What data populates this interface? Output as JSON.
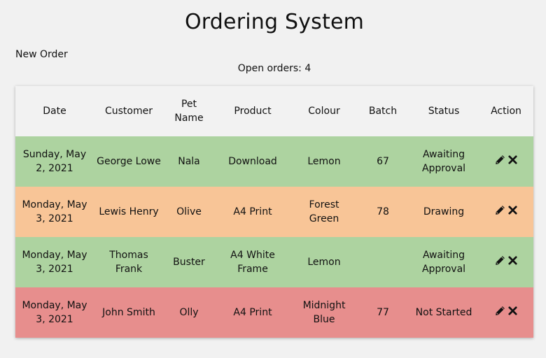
{
  "title": "Ordering System",
  "new_order_label": "New Order",
  "open_orders": "Open orders: 4",
  "table": {
    "headers": {
      "date": "Date",
      "customer": "Customer",
      "pet_name": "Pet Name",
      "product": "Product",
      "colour": "Colour",
      "batch": "Batch",
      "status": "Status",
      "action": "Action"
    },
    "rows": [
      {
        "date": "Sunday, May 2, 2021",
        "customer": "George Lowe",
        "pet_name": "Nala",
        "product": "Download",
        "colour": "Lemon",
        "batch": "67",
        "status": "Awaiting Approval",
        "row_color": "#add3a0"
      },
      {
        "date": "Monday, May 3, 2021",
        "customer": "Lewis Henry",
        "pet_name": "Olive",
        "product": "A4 Print",
        "colour": "Forest Green",
        "batch": "78",
        "status": "Drawing",
        "row_color": "#f8c597"
      },
      {
        "date": "Monday, May 3, 2021",
        "customer": "Thomas Frank",
        "pet_name": "Buster",
        "product": "A4 White Frame",
        "colour": "Lemon",
        "batch": "",
        "status": "Awaiting Approval",
        "row_color": "#add3a0"
      },
      {
        "date": "Monday, May 3, 2021",
        "customer": "John Smith",
        "pet_name": "Olly",
        "product": "A4 Print",
        "colour": "Midnight Blue",
        "batch": "77",
        "status": "Not Started",
        "row_color": "#e78e8d"
      }
    ],
    "row_icons": [
      "pencil-icon",
      "close-icon"
    ]
  },
  "colors": {
    "background": "#f1f1f1",
    "header_row": "#f2f2f2",
    "awaiting_approval": "#add3a0",
    "drawing": "#f8c597",
    "not_started": "#e78e8d"
  }
}
